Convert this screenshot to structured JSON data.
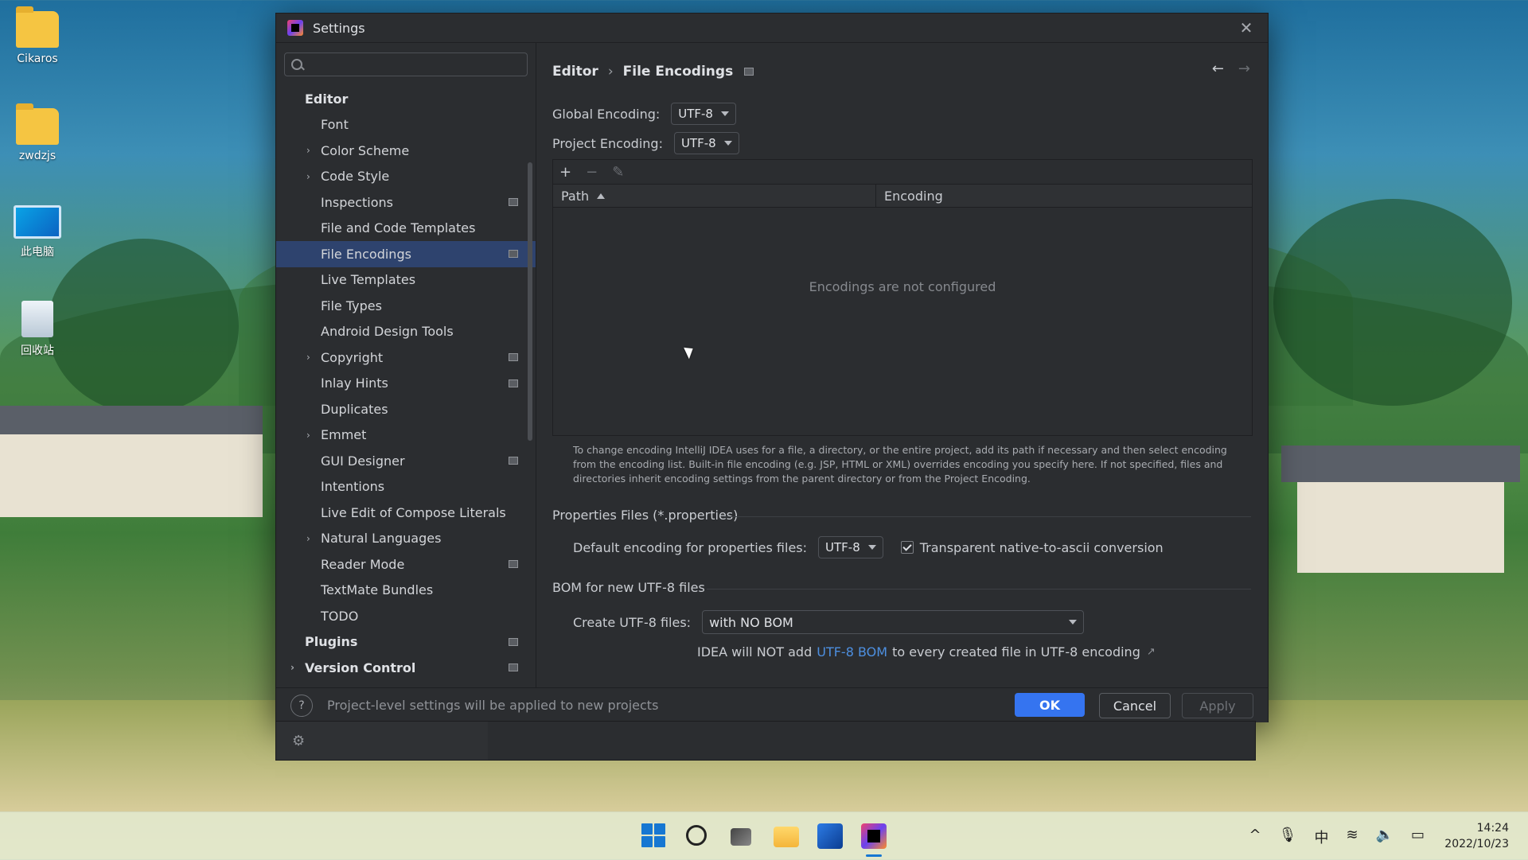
{
  "desktop": {
    "icons": [
      {
        "label": "Cikaros"
      },
      {
        "label": "zwdzjs"
      },
      {
        "label": "此电脑"
      },
      {
        "label": "回收站"
      }
    ]
  },
  "window": {
    "title": "Settings",
    "search": {
      "value": "",
      "placeholder": ""
    },
    "sidebar": {
      "items": [
        {
          "label": "Editor"
        },
        {
          "label": "Font"
        },
        {
          "label": "Color Scheme"
        },
        {
          "label": "Code Style"
        },
        {
          "label": "Inspections"
        },
        {
          "label": "File and Code Templates"
        },
        {
          "label": "File Encodings"
        },
        {
          "label": "Live Templates"
        },
        {
          "label": "File Types"
        },
        {
          "label": "Android Design Tools"
        },
        {
          "label": "Copyright"
        },
        {
          "label": "Inlay Hints"
        },
        {
          "label": "Duplicates"
        },
        {
          "label": "Emmet"
        },
        {
          "label": "GUI Designer"
        },
        {
          "label": "Intentions"
        },
        {
          "label": "Live Edit of Compose Literals"
        },
        {
          "label": "Natural Languages"
        },
        {
          "label": "Reader Mode"
        },
        {
          "label": "TextMate Bundles"
        },
        {
          "label": "TODO"
        },
        {
          "label": "Plugins"
        },
        {
          "label": "Version Control"
        }
      ]
    },
    "breadcrumb": {
      "parent": "Editor",
      "separator": "›",
      "current": "File Encodings"
    },
    "global_encoding": {
      "label": "Global Encoding:",
      "value": "UTF-8"
    },
    "project_encoding": {
      "label": "Project Encoding:",
      "value": "UTF-8"
    },
    "table": {
      "toolbar": {
        "add": "+",
        "remove": "−",
        "edit": "✎"
      },
      "columns": {
        "path": "Path",
        "encoding": "Encoding"
      },
      "empty_text": "Encodings are not configured"
    },
    "hint": "To change encoding IntelliJ IDEA uses for a file, a directory, or the entire project, add its path if necessary and then select encoding from the encoding list. Built-in file encoding (e.g. JSP, HTML or XML) overrides encoding you specify here. If not specified, files and directories inherit encoding settings from the parent directory or from the Project Encoding.",
    "properties": {
      "section_title": "Properties Files (*.properties)",
      "default_label": "Default encoding for properties files:",
      "default_value": "UTF-8",
      "transparent_label": "Transparent native-to-ascii conversion"
    },
    "bom": {
      "section_title": "BOM for new UTF-8 files",
      "create_label": "Create UTF-8 files:",
      "create_value": "with NO BOM",
      "info_before": "IDEA will NOT add",
      "info_link": "UTF-8 BOM",
      "info_after": "to every created file in UTF-8 encoding",
      "info_arrow": "↗"
    },
    "footer": {
      "help": "?",
      "message": "Project-level settings will be applied to new projects",
      "ok": "OK",
      "cancel": "Cancel",
      "apply": "Apply"
    }
  },
  "taskbar": {
    "tray": {
      "up": "^",
      "mic": "🎙",
      "ime": "中",
      "wifi": "≋",
      "volume": "🔈",
      "battery": "▭"
    },
    "time": "14:24",
    "date": "2022/10/23"
  },
  "colors": {
    "accent": "#3574f0",
    "selection": "#2e436e",
    "link": "#4d8fe0"
  }
}
